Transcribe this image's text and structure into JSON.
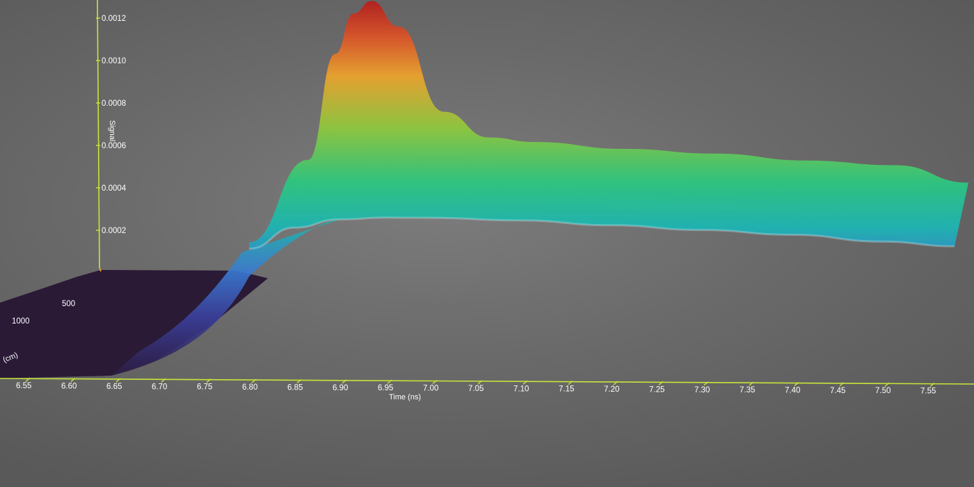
{
  "chart_data": {
    "type": "surface",
    "title": "",
    "xlabel": "Time (ns)",
    "ylabel": "Signal",
    "zlabel_partial": "(cm)",
    "x_ticks": [
      "6.55",
      "6.60",
      "6.65",
      "6.70",
      "6.75",
      "6.80",
      "6.85",
      "6.90",
      "6.95",
      "7.00",
      "7.05",
      "7.10",
      "7.15",
      "7.20",
      "7.25",
      "7.30",
      "7.35",
      "7.40",
      "7.45",
      "7.50",
      "7.55"
    ],
    "y_ticks": [
      "0.0002",
      "0.0004",
      "0.0006",
      "0.0008",
      "0.0010",
      "0.0012"
    ],
    "z_ticks": [
      "500",
      "1000"
    ],
    "xlim": [
      6.53,
      7.58
    ],
    "ylim": [
      0,
      0.00125
    ],
    "colormap": [
      "#2b1a3c",
      "#3b3f9b",
      "#3a79d2",
      "#1fb3b1",
      "#2ec47f",
      "#8cc63f",
      "#e8a12e",
      "#d8562a",
      "#b11e1e"
    ],
    "series": [
      {
        "x": [
          6.53,
          6.6,
          6.65,
          6.7,
          6.75,
          6.8,
          6.85,
          6.88,
          6.9,
          6.92,
          6.95,
          7.0,
          7.05,
          7.1,
          7.2,
          7.3,
          7.4,
          7.5,
          7.58
        ],
        "y": [
          0,
          0,
          0,
          2e-05,
          6e-05,
          0.00016,
          0.00055,
          0.00105,
          0.00124,
          0.0013,
          0.00118,
          0.00078,
          0.00066,
          0.00064,
          0.00061,
          0.00059,
          0.00056,
          0.00054,
          0.00046
        ]
      },
      {
        "x": [
          6.53,
          6.6,
          6.65,
          6.7,
          6.75,
          6.8,
          6.85,
          6.9,
          6.95,
          7.0,
          7.1,
          7.2,
          7.3,
          7.4,
          7.5,
          7.58
        ],
        "y": [
          0,
          0,
          0,
          2e-05,
          6e-05,
          0.00013,
          0.00023,
          0.00027,
          0.00028,
          0.00028,
          0.00027,
          0.00025,
          0.00023,
          0.00021,
          0.00018,
          0.00016
        ]
      }
    ]
  }
}
